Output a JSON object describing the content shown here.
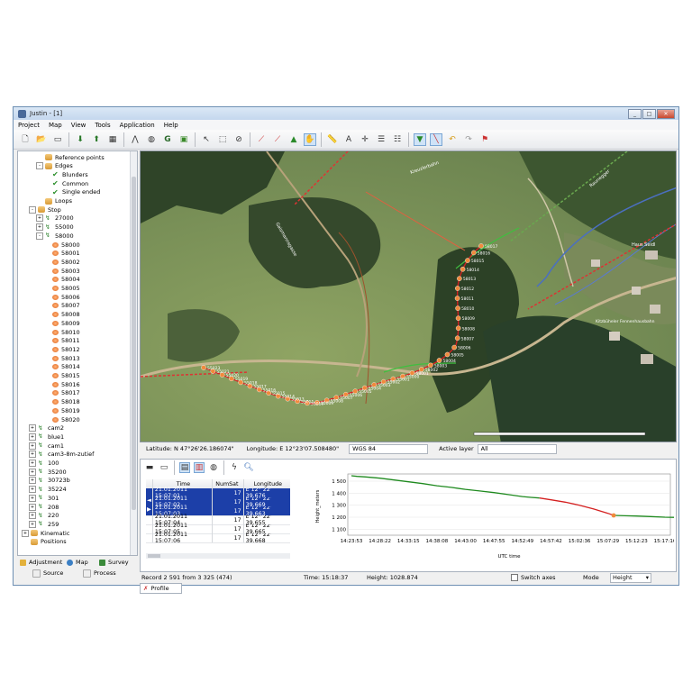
{
  "window": {
    "title": "Justin - [1]",
    "controls": [
      "minimize",
      "maximize",
      "close"
    ]
  },
  "menu": [
    "Project",
    "Map",
    "View",
    "Tools",
    "Application",
    "Help"
  ],
  "toolbar_icons": [
    "new-file-icon",
    "open-folder-icon",
    "save-icon",
    "import-icon",
    "export-icon",
    "database-icon",
    "compass-icon",
    "globe-icon",
    "letter-g-icon",
    "map-layer-icon",
    "pointer-icon",
    "select-area-icon",
    "no-entry-icon",
    "line-tool-icon",
    "measure-icon",
    "triangle-tool-icon",
    "pan-hand-icon",
    "ruler-icon",
    "north-arrow-icon",
    "crosshair-icon",
    "list-icon",
    "list-sort-icon",
    "accept-icon",
    "line-draw-icon",
    "undo-icon",
    "redo-icon",
    "flag-icon"
  ],
  "tree": {
    "items": [
      {
        "label": "Reference points",
        "icon": "folder",
        "indent": 2,
        "exp": ""
      },
      {
        "label": "Edges",
        "icon": "folder",
        "indent": 2,
        "exp": "-"
      },
      {
        "label": "Blunders",
        "icon": "check",
        "indent": 3,
        "exp": ""
      },
      {
        "label": "Common",
        "icon": "check",
        "indent": 3,
        "exp": ""
      },
      {
        "label": "Single ended",
        "icon": "check",
        "indent": 3,
        "exp": ""
      },
      {
        "label": "Loops",
        "icon": "folder",
        "indent": 2,
        "exp": ""
      },
      {
        "label": "Stop",
        "icon": "folder",
        "indent": 1,
        "exp": "-"
      },
      {
        "label": "27000",
        "icon": "track",
        "indent": 2,
        "exp": "+"
      },
      {
        "label": "55000",
        "icon": "track",
        "indent": 2,
        "exp": "+"
      },
      {
        "label": "58000",
        "icon": "track",
        "indent": 2,
        "exp": "-"
      },
      {
        "label": "58000",
        "icon": "dot",
        "indent": 3,
        "exp": ""
      },
      {
        "label": "58001",
        "icon": "dot",
        "indent": 3,
        "exp": ""
      },
      {
        "label": "58002",
        "icon": "dot",
        "indent": 3,
        "exp": ""
      },
      {
        "label": "58003",
        "icon": "dot",
        "indent": 3,
        "exp": ""
      },
      {
        "label": "58004",
        "icon": "dot",
        "indent": 3,
        "exp": ""
      },
      {
        "label": "58005",
        "icon": "dot",
        "indent": 3,
        "exp": ""
      },
      {
        "label": "58006",
        "icon": "dot",
        "indent": 3,
        "exp": ""
      },
      {
        "label": "58007",
        "icon": "dot",
        "indent": 3,
        "exp": ""
      },
      {
        "label": "58008",
        "icon": "dot",
        "indent": 3,
        "exp": ""
      },
      {
        "label": "58009",
        "icon": "dot",
        "indent": 3,
        "exp": ""
      },
      {
        "label": "58010",
        "icon": "dot",
        "indent": 3,
        "exp": ""
      },
      {
        "label": "58011",
        "icon": "dot",
        "indent": 3,
        "exp": ""
      },
      {
        "label": "58012",
        "icon": "dot",
        "indent": 3,
        "exp": ""
      },
      {
        "label": "58013",
        "icon": "dot",
        "indent": 3,
        "exp": ""
      },
      {
        "label": "58014",
        "icon": "dot",
        "indent": 3,
        "exp": ""
      },
      {
        "label": "58015",
        "icon": "dot",
        "indent": 3,
        "exp": ""
      },
      {
        "label": "58016",
        "icon": "dot",
        "indent": 3,
        "exp": ""
      },
      {
        "label": "58017",
        "icon": "dot",
        "indent": 3,
        "exp": ""
      },
      {
        "label": "58018",
        "icon": "dot",
        "indent": 3,
        "exp": ""
      },
      {
        "label": "58019",
        "icon": "dot",
        "indent": 3,
        "exp": ""
      },
      {
        "label": "58020",
        "icon": "dot",
        "indent": 3,
        "exp": ""
      },
      {
        "label": "cam2",
        "icon": "track",
        "indent": 1,
        "exp": "+"
      },
      {
        "label": "blue1",
        "icon": "track",
        "indent": 1,
        "exp": "+"
      },
      {
        "label": "cam1",
        "icon": "track",
        "indent": 1,
        "exp": "+"
      },
      {
        "label": "cam3-8m-zutief",
        "icon": "track",
        "indent": 1,
        "exp": "+"
      },
      {
        "label": "100",
        "icon": "track",
        "indent": 1,
        "exp": "+"
      },
      {
        "label": "35200",
        "icon": "track",
        "indent": 1,
        "exp": "+"
      },
      {
        "label": "30723b",
        "icon": "track",
        "indent": 1,
        "exp": "+"
      },
      {
        "label": "35224",
        "icon": "track",
        "indent": 1,
        "exp": "+"
      },
      {
        "label": "301",
        "icon": "track",
        "indent": 1,
        "exp": "+"
      },
      {
        "label": "208",
        "icon": "track",
        "indent": 1,
        "exp": "+"
      },
      {
        "label": "220",
        "icon": "track",
        "indent": 1,
        "exp": "+"
      },
      {
        "label": "259",
        "icon": "track",
        "indent": 1,
        "exp": "+"
      },
      {
        "label": "Kinematic",
        "icon": "folder",
        "indent": 0,
        "exp": "+"
      },
      {
        "label": "Positions",
        "icon": "folder",
        "indent": 0,
        "exp": ""
      }
    ]
  },
  "left_tabs": {
    "adjustment": "Adjustment",
    "map": "Map",
    "survey": "Survey",
    "source": "Source",
    "process": "Process"
  },
  "map": {
    "points": [
      "58017",
      "58016",
      "58015",
      "58014",
      "58013",
      "58012",
      "58011",
      "58010",
      "58009",
      "58008",
      "58007",
      "58006",
      "58005",
      "58004",
      "58003",
      "58002",
      "58001",
      "55000",
      "55001",
      "55002",
      "55003",
      "55004",
      "55005",
      "55006",
      "55007",
      "55008",
      "55009",
      "55010",
      "55011",
      "55013",
      "55014",
      "55015",
      "55016",
      "55017",
      "55018",
      "55019",
      "55020",
      "55021",
      "55023"
    ],
    "road_labels": [
      "Gaismannsgasse",
      "Kreuzlerbahn",
      "Raunegger"
    ],
    "place_labels": [
      "Haus Seidl",
      "Kitzbüheler Fennenhausbahn"
    ]
  },
  "coords": {
    "latitude": "Latitude: N 47°26'26.186074\"",
    "longitude": "Longitude: E 12°23'07.508480\"",
    "datum": "WGS 84",
    "active_layer_label": "Active layer",
    "active_layer_value": "All"
  },
  "table": {
    "headers": [
      "Time",
      "NumSat",
      "Longitude"
    ],
    "rows": [
      {
        "marker": "",
        "time": "21.01.2011 15:07:01",
        "numsat": "17",
        "lon": "E 12° 22' 39.676",
        "selected": true
      },
      {
        "marker": "◄",
        "time": "21.01.2011 15:07:02",
        "numsat": "17",
        "lon": "E 12° 22' 39.669",
        "selected": true
      },
      {
        "marker": "▶",
        "time": "21.01.2011 15:07:03",
        "numsat": "17",
        "lon": "E 12° 22' 39.663",
        "selected": true
      },
      {
        "marker": "",
        "time": "21.01.2011 15:07:04",
        "numsat": "17",
        "lon": "E 12° 22' 39.655",
        "selected": false
      },
      {
        "marker": "",
        "time": "21.01.2011 15:07:05",
        "numsat": "17",
        "lon": "E 12° 22' 39.665",
        "selected": false
      },
      {
        "marker": "",
        "time": "21.01.2011 15:07:06",
        "numsat": "17",
        "lon": "E 12° 22' 39.668",
        "selected": false
      }
    ]
  },
  "chart_data": {
    "type": "line",
    "xlabel": "UTC time",
    "ylabel": "Height_meters",
    "ylim": [
      1050,
      1560
    ],
    "yticks": [
      1100,
      1200,
      1300,
      1400,
      1500
    ],
    "ytick_labels": [
      "1 100",
      "1 200",
      "1 300",
      "1 400",
      "1 500"
    ],
    "x_categories": [
      "14:23:53",
      "14:28:22",
      "14:33:15",
      "14:38:08",
      "14:43:00",
      "14:47:55",
      "14:52:49",
      "14:57:42",
      "15:02:36",
      "15:07:29",
      "15:12:23",
      "15:17:16"
    ],
    "series": [
      {
        "color": "#1f8a1f",
        "x": [
          0,
          0.2,
          0.5,
          1,
          1.5,
          2,
          2.5,
          3,
          3.5,
          4,
          4.5,
          5,
          5.5,
          6,
          6.3,
          6.6
        ],
        "y": [
          1545,
          1540,
          1535,
          1525,
          1510,
          1495,
          1480,
          1462,
          1448,
          1432,
          1418,
          1405,
          1388,
          1372,
          1365,
          1360
        ]
      },
      {
        "color": "#d42020",
        "x": [
          6.6,
          7,
          7.5,
          8,
          8.5,
          9,
          9.2
        ],
        "y": [
          1360,
          1345,
          1325,
          1300,
          1268,
          1232,
          1215
        ]
      },
      {
        "color": "#1f8a1f",
        "x": [
          9.2,
          9.6,
          10,
          10.5,
          11,
          11.5,
          11.8
        ],
        "y": [
          1215,
          1212,
          1210,
          1205,
          1200,
          1198,
          1150
        ]
      }
    ]
  },
  "status": {
    "record": "Record 2 591 from 3 325 (474)",
    "time": "Time: 15:18:37",
    "height": "Height: 1028.874",
    "switch_axes": "Switch axes",
    "mode_label": "Mode",
    "mode_value": "Height"
  },
  "profile_tab": "Profile"
}
